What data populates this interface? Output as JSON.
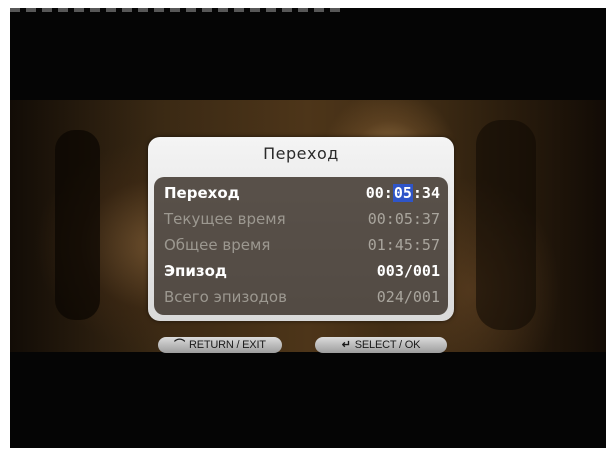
{
  "dialog": {
    "title": "Переход",
    "rows": [
      {
        "label": "Переход",
        "value_prefix": "00:",
        "value_cursor": "05",
        "value_suffix": ":34",
        "emphasis": "bright"
      },
      {
        "label": "Текущее время",
        "value": "00:05:37",
        "emphasis": "dim"
      },
      {
        "label": "Общее время",
        "value": "01:45:57",
        "emphasis": "dim"
      },
      {
        "label": "Эпизод",
        "value": "003/001",
        "emphasis": "bright"
      },
      {
        "label": "Всего эпизодов",
        "value": "024/001",
        "emphasis": "dim"
      }
    ]
  },
  "hints": {
    "return": {
      "icon": "return-arrow-icon",
      "glyph": "⌒",
      "label": "RETURN / EXIT"
    },
    "select": {
      "icon": "enter-arrow-icon",
      "glyph": "↵",
      "label": "SELECT / OK"
    }
  },
  "colors": {
    "cursor_highlight": "#2f55c8",
    "dialog_frame": "#e6e6e6",
    "bright_text": "#ffffff",
    "dim_text": "#9c9890"
  }
}
